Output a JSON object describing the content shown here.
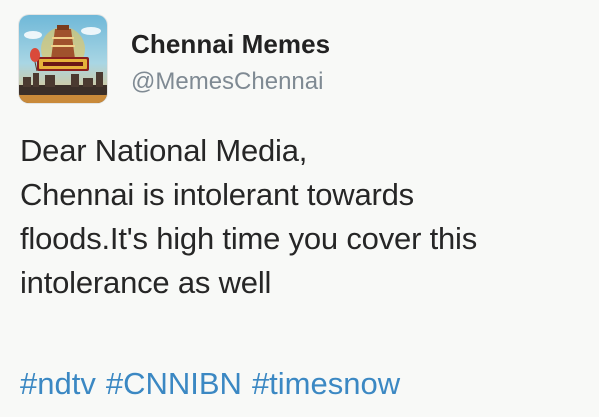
{
  "tweet": {
    "display_name": "Chennai Memes",
    "handle": "@MemesChennai",
    "text_lines": [
      "Dear National Media,",
      "Chennai is intolerant towards",
      "floods.It's high time you cover this",
      "intolerance as well"
    ],
    "hashtags": [
      "#ndtv",
      "#CNNIBN",
      "#timesnow"
    ],
    "hashtag_color": "#3b88c3",
    "avatar": {
      "icon": "chennai-memes-logo-avatar"
    }
  }
}
